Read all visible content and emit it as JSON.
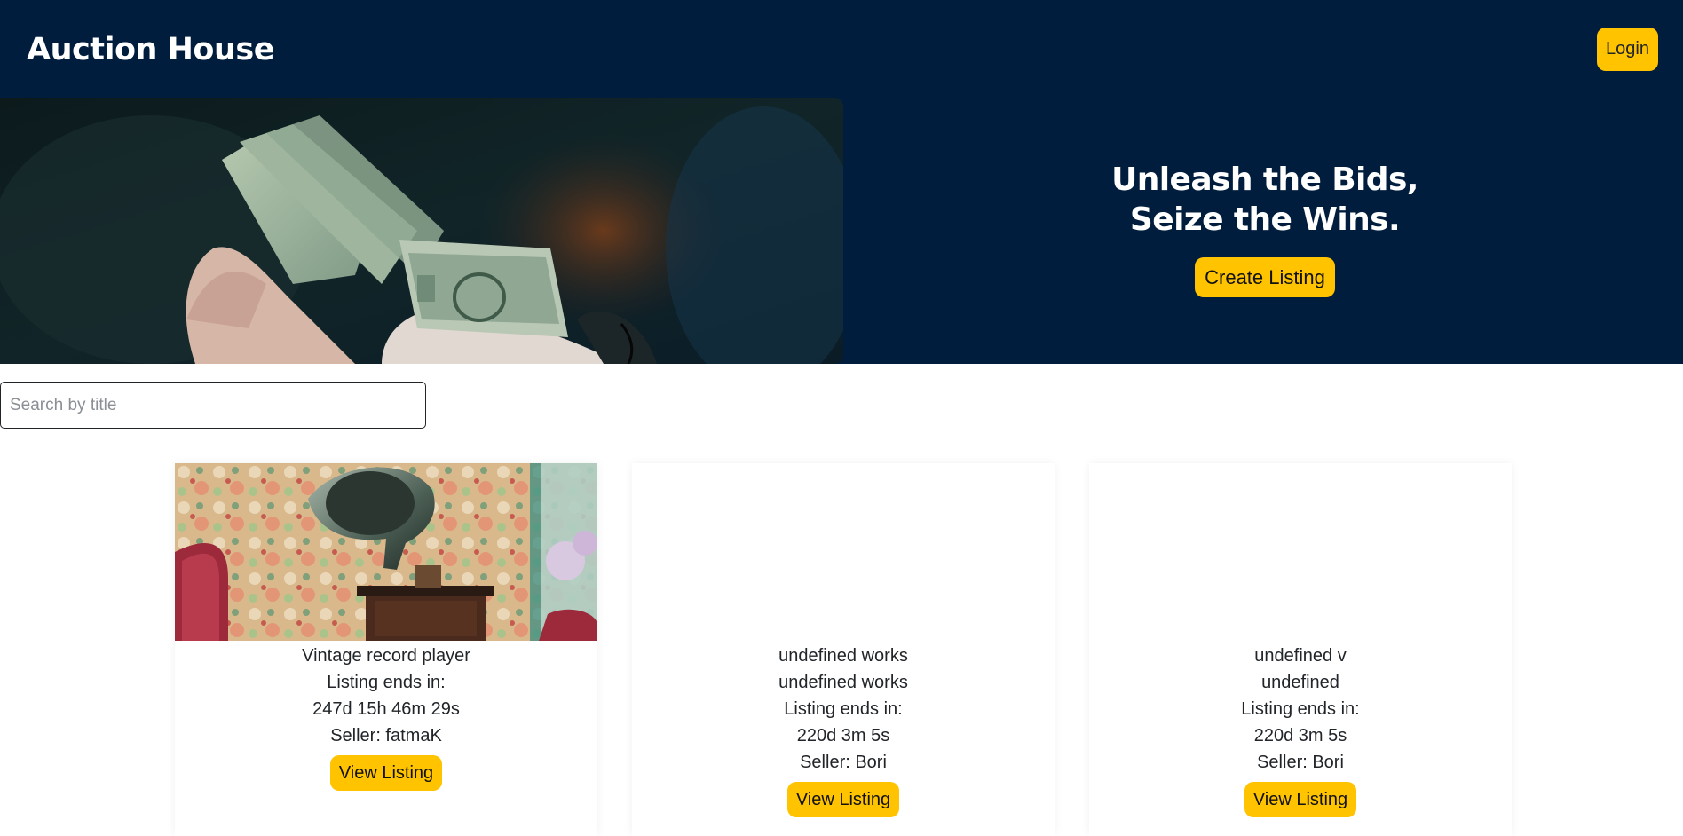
{
  "header": {
    "brand": "Auction House",
    "login_label": "Login"
  },
  "hero": {
    "tagline_line1": "Unleash the Bids,",
    "tagline_line2": "Seize the Wins.",
    "create_label": "Create Listing"
  },
  "search": {
    "placeholder": "Search by title",
    "value": ""
  },
  "listings": [
    {
      "title": "Vintage record player",
      "ends_label": "Listing ends in:",
      "countdown": "247d 15h 46m 29s",
      "seller": "Seller: fatmaK",
      "view_label": "View Listing"
    },
    {
      "title": "undefined works",
      "description": "undefined works",
      "ends_label": "Listing ends in:",
      "countdown": "220d 3m 5s",
      "seller": "Seller: Bori",
      "view_label": "View Listing"
    },
    {
      "title": "undefined v",
      "description": "undefined",
      "ends_label": "Listing ends in:",
      "countdown": "220d 3m 5s",
      "seller": "Seller: Bori",
      "view_label": "View Listing"
    }
  ],
  "colors": {
    "navy": "#001d3d",
    "accent": "#ffc300"
  }
}
